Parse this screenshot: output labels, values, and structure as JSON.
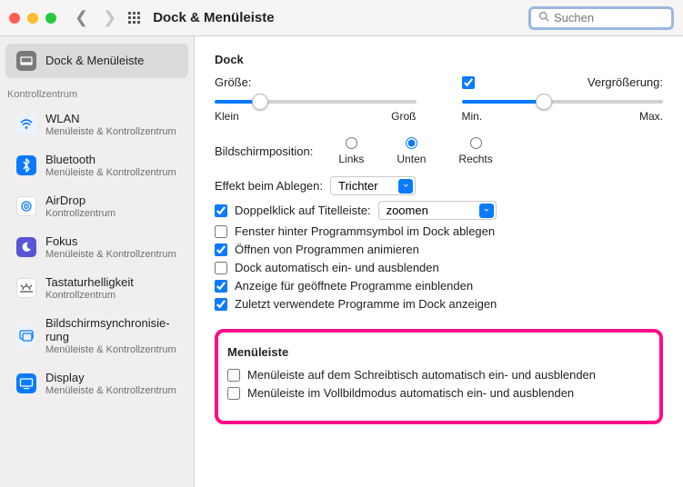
{
  "window": {
    "title": "Dock & Menüleiste"
  },
  "search": {
    "placeholder": "Suchen"
  },
  "sidebar": {
    "section": "Kontrollzentrum",
    "items": [
      {
        "label": "Dock & Menüleiste",
        "sub": ""
      },
      {
        "label": "WLAN",
        "sub": "Menüleiste & Kontrollzentrum"
      },
      {
        "label": "Bluetooth",
        "sub": "Menüleiste & Kontrollzentrum"
      },
      {
        "label": "AirDrop",
        "sub": "Kontrollzentrum"
      },
      {
        "label": "Fokus",
        "sub": "Menüleiste & Kontrollzentrum"
      },
      {
        "label": "Tastaturhelligkeit",
        "sub": "Kontrollzentrum"
      },
      {
        "label": "Bildschirmsynchronisie­rung",
        "sub": "Menüleiste & Kontrollzentrum"
      },
      {
        "label": "Display",
        "sub": "Menüleiste & Kontrollzentrum"
      }
    ]
  },
  "dock": {
    "heading": "Dock",
    "size_label": "Größe:",
    "size_min": "Klein",
    "size_max": "Groß",
    "mag_label": "Vergrößerung:",
    "mag_min": "Min.",
    "mag_max": "Max.",
    "pos_label": "Bildschirmposition:",
    "pos_left": "Links",
    "pos_bottom": "Unten",
    "pos_right": "Rechts",
    "effect_label": "Effekt beim Ablegen:",
    "effect_value": "Trichter",
    "dblclick_label": "Doppelklick auf Titelleiste:",
    "dblclick_value": "zoomen",
    "opt_minimize": "Fenster hinter Programmsymbol im Dock ablegen",
    "opt_animate": "Öffnen von Programmen animieren",
    "opt_autohide": "Dock automatisch ein- und ausblenden",
    "opt_indicators": "Anzeige für geöffnete Programme einblenden",
    "opt_recent": "Zuletzt verwendete Programme im Dock anzeigen"
  },
  "menubar": {
    "heading": "Menüleiste",
    "opt_desktop": "Menüleiste auf dem Schreibtisch automatisch ein- und ausblenden",
    "opt_fullscreen": "Menüleiste im Vollbildmodus automatisch ein- und ausblenden"
  }
}
